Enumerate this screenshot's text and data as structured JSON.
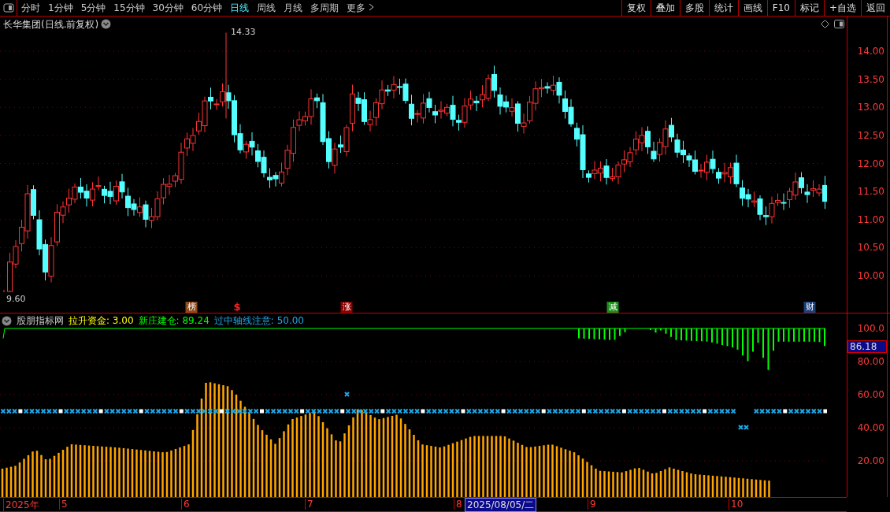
{
  "toolbar": {
    "periods": [
      {
        "label": "分时",
        "selected": false
      },
      {
        "label": "1分钟",
        "selected": false
      },
      {
        "label": "5分钟",
        "selected": false
      },
      {
        "label": "15分钟",
        "selected": false
      },
      {
        "label": "30分钟",
        "selected": false
      },
      {
        "label": "60分钟",
        "selected": false
      },
      {
        "label": "日线",
        "selected": true
      },
      {
        "label": "周线",
        "selected": false
      },
      {
        "label": "月线",
        "selected": false
      },
      {
        "label": "多周期",
        "selected": false
      }
    ],
    "more": "更多",
    "actions": [
      "复权",
      "叠加",
      "多股",
      "统计",
      "画线",
      "F10",
      "标记",
      "+自选",
      "返回"
    ]
  },
  "price_chart": {
    "title": "长华集团(日线.前复权)",
    "high_label": "14.33",
    "low_label": "9.60",
    "axis_labels": [
      "14.00",
      "13.50",
      "13.00",
      "12.50",
      "12.00",
      "11.50",
      "11.00",
      "10.50",
      "10.00"
    ],
    "event_markers": [
      {
        "label": "榜",
        "kind": "boxed",
        "color": "#8b4a1c"
      },
      {
        "label": "$",
        "kind": "plain",
        "color": "#ff2020"
      },
      {
        "label": "涨",
        "kind": "boxed",
        "color": "#8b0000"
      },
      {
        "label": "减",
        "kind": "boxed",
        "color": "#1a8f1a"
      },
      {
        "label": "财",
        "kind": "boxed",
        "color": "#1a3f7a"
      }
    ]
  },
  "indicator": {
    "name": "股朋指标网",
    "lines": [
      {
        "label": "拉升资金: 3.00",
        "color": "#ffff00"
      },
      {
        "label": "新庄建仓: 89.24",
        "color": "#00ff00"
      },
      {
        "label": "过中轴线注意: 50.00",
        "color": "#1ea8e8"
      }
    ],
    "axis_labels": [
      "100.0",
      "80.00",
      "60.00",
      "40.00",
      "20.00"
    ],
    "current_value": "86.18"
  },
  "date_axis": {
    "labels": [
      "2025年",
      "5",
      "6",
      "7",
      "8",
      "9",
      "10"
    ],
    "cursor": "2025/08/05/二"
  }
}
